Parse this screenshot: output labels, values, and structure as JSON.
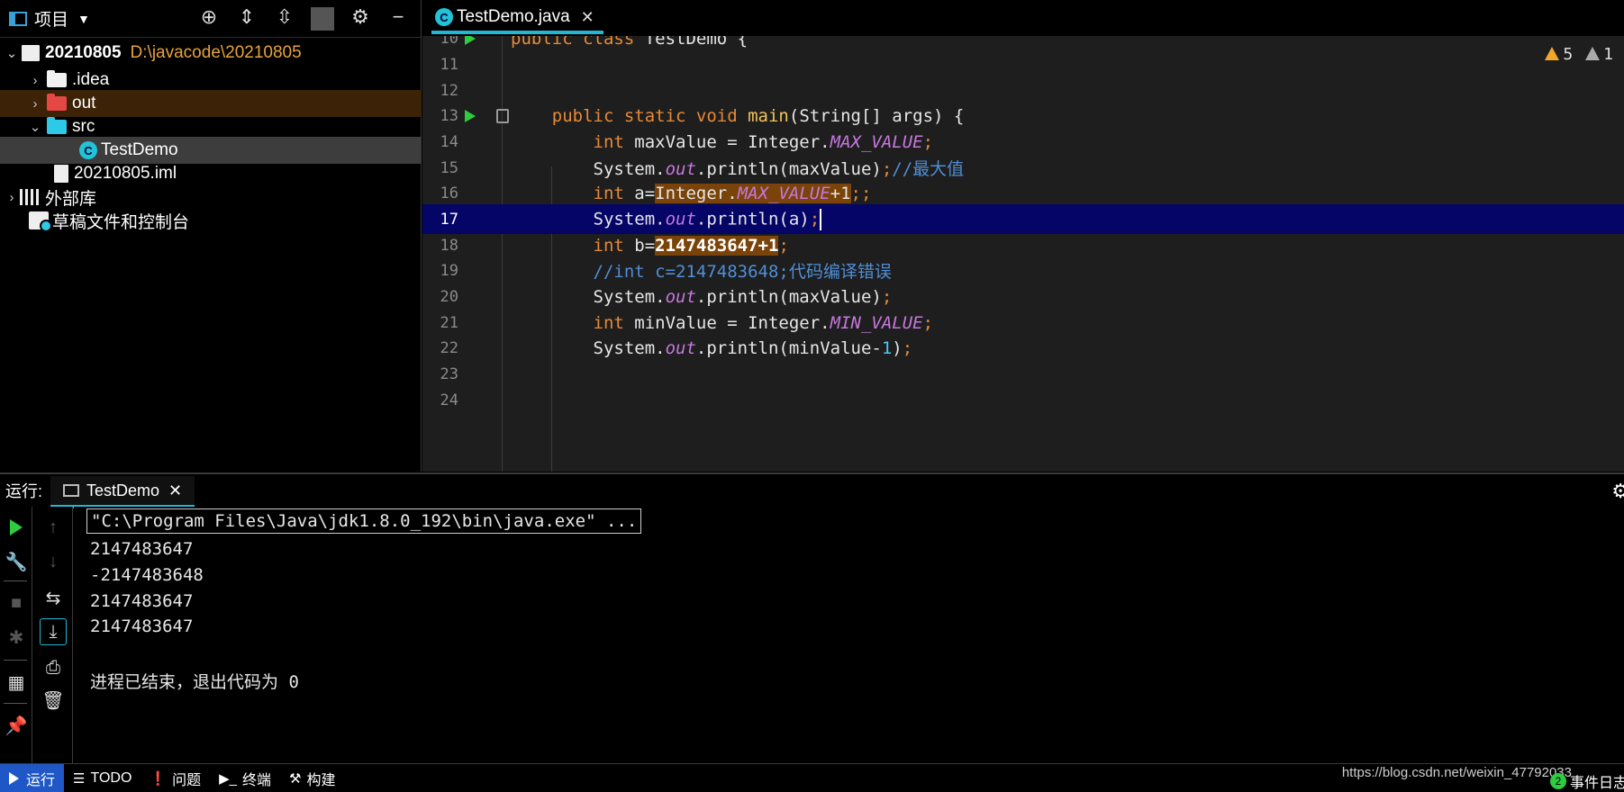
{
  "project_panel": {
    "title": "项目",
    "tree": [
      {
        "name": "20210805",
        "path": "D:\\javacode\\20210805",
        "expanded": true
      },
      {
        "name": ".idea",
        "expanded": false
      },
      {
        "name": "out",
        "expanded": false
      },
      {
        "name": "src",
        "expanded": true
      },
      {
        "name": "TestDemo"
      },
      {
        "name": "20210805.iml"
      },
      {
        "name": "外部库",
        "expanded": false
      },
      {
        "name": "草稿文件和控制台"
      }
    ]
  },
  "editor": {
    "tab_label": "TestDemo.java",
    "inspections": {
      "warnings": "5",
      "weak_warnings": "1"
    },
    "lines": [
      {
        "num": "10",
        "text": "public class TestDemo {"
      },
      {
        "num": "11",
        "text": ""
      },
      {
        "num": "12",
        "text": ""
      },
      {
        "num": "13",
        "text": "    public static void main(String[] args) {"
      },
      {
        "num": "14",
        "text": "        int maxValue = Integer.MAX_VALUE;"
      },
      {
        "num": "15",
        "text": "        System.out.println(maxValue);//最大值"
      },
      {
        "num": "16",
        "text": "        int a=Integer.MAX_VALUE+1;;"
      },
      {
        "num": "17",
        "text": "        System.out.println(a);"
      },
      {
        "num": "18",
        "text": "        int b=2147483647+1;"
      },
      {
        "num": "19",
        "text": "        //int c=2147483648;代码编译错误"
      },
      {
        "num": "20",
        "text": "        System.out.println(maxValue);"
      },
      {
        "num": "21",
        "text": "        int minValue = Integer.MIN_VALUE;"
      },
      {
        "num": "22",
        "text": "        System.out.println(minValue-1);"
      },
      {
        "num": "23",
        "text": ""
      },
      {
        "num": "24",
        "text": ""
      }
    ],
    "current_line": "17"
  },
  "run_panel": {
    "label": "运行:",
    "tab_label": "TestDemo",
    "console": [
      "\"C:\\Program Files\\Java\\jdk1.8.0_192\\bin\\java.exe\" ...",
      "2147483647",
      "-2147483648",
      "2147483647",
      "2147483647",
      "",
      "进程已结束，退出代码为 0"
    ]
  },
  "statusbar": {
    "items": [
      "运行",
      "TODO",
      "问题",
      "终端",
      "构建"
    ],
    "watermark": "https://blog.csdn.net/weixin_47792033",
    "event_log": "事件日志",
    "event_count": "2"
  },
  "colors": {
    "accent": "#22b8d4",
    "current_line": "#040567",
    "highlight": "#7a4309",
    "keyword": "#e68a37",
    "constant": "#c677dd",
    "comment": "#4f8ed6",
    "number": "#4ec8f0",
    "run_green": "#2ecc40",
    "statusbar_active": "#1f57c6"
  }
}
